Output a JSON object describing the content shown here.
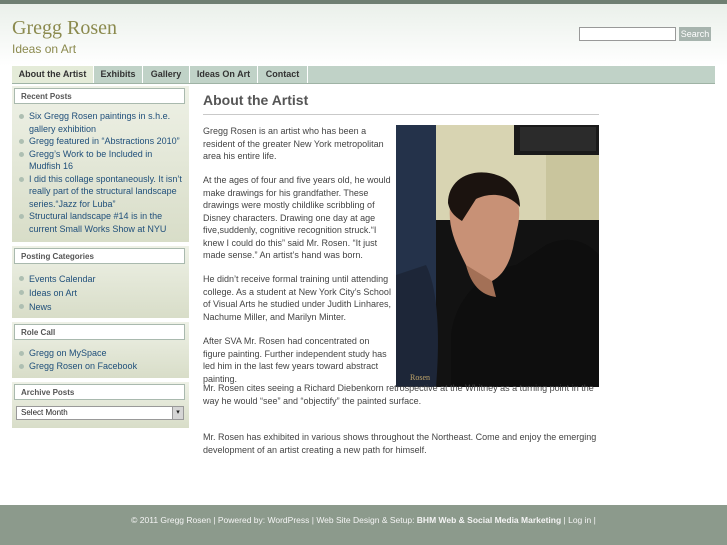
{
  "site": {
    "title": "Gregg Rosen",
    "tagline": "Ideas on Art"
  },
  "search": {
    "value": "",
    "placeholder": "",
    "button_label": "Search"
  },
  "nav": {
    "items": [
      {
        "label": "About the Artist",
        "active": true
      },
      {
        "label": "Exhibits"
      },
      {
        "label": "Gallery"
      },
      {
        "label": "Ideas On Art"
      },
      {
        "label": "Contact"
      }
    ]
  },
  "sidebar": {
    "recent_posts": {
      "title": "Recent Posts",
      "items": [
        "Six Gregg Rosen paintings in s.h.e. gallery exhibition",
        "Gregg featured in “Abstractions 2010”",
        "Gregg’s Work to be Included in Mudfish 16",
        "I did this collage spontaneously. It isn’t really part of the structural landscape series.“Jazz for Luba”",
        "Structural landscape #14 is in the current Small Works Show at NYU"
      ]
    },
    "posting_categories": {
      "title": "Posting Categories",
      "items": [
        "Events Calendar",
        "Ideas on Art",
        "News"
      ]
    },
    "role_call": {
      "title": "Role Call",
      "items": [
        "Gregg on MySpace",
        "Gregg Rosen on Facebook"
      ]
    },
    "archive_posts": {
      "title": "Archive Posts",
      "select_value": "Select Month"
    }
  },
  "main": {
    "page_title": "About the Artist",
    "image_caption": "Rosen",
    "paragraphs": [
      "Gregg Rosen is an artist who has been a resident of the greater New York metropolitan area his entire life.",
      "At the ages of four and five years old, he would make drawings for his grandfather. These drawings were mostly childlike scribbling of Disney characters. Drawing one day at age five,suddenly, cognitive recognition struck.“I knew I could do this” said Mr. Rosen. “It just made sense.” An artist’s hand was born.",
      "He didn’t receive formal training until attending college. As a student at New York City’s School of Visual Arts he studied under Judith Linhares, Nachume Miller, and Marilyn Minter.",
      "After SVA Mr. Rosen had concentrated on figure painting. Further independent study has led him in the last few years toward abstract painting.",
      "Mr. Rosen cites seeing a Richard Diebenkorn retrospective at the Whitney as a turning point in the way he would “see” and “objectify” the painted surface.",
      "Mr. Rosen has exhibited in various shows throughout the Northeast. Come and enjoy the emerging development of an artist creating a new path for himself."
    ]
  },
  "footer": {
    "copyright": "© 2011 Gregg Rosen | Powered by: WordPress | Web Site Design & Setup: ",
    "designer": "BHM Web & Social Media Marketing",
    "login": " | Log in |"
  },
  "colors": {
    "accent": "#8b8a4e",
    "nav_bg": "#c0d2c7",
    "footer_bg": "#8c9a8c",
    "link": "#1f4f7a"
  }
}
